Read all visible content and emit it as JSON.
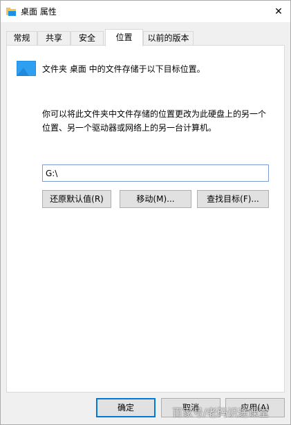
{
  "window": {
    "title": "桌面 属性",
    "close_glyph": "✕"
  },
  "tabs": [
    {
      "label": "常规",
      "active": false
    },
    {
      "label": "共享",
      "active": false
    },
    {
      "label": "安全",
      "active": false
    },
    {
      "label": "位置",
      "active": true
    },
    {
      "label": "以前的版本",
      "active": false
    }
  ],
  "location": {
    "info": "文件夹 桌面 中的文件存储于以下目标位置。",
    "description_line1": "你可以将此文件夹中文件存储的位置更改为此硬盘上的另一个",
    "description_line2": "位置、另一个驱动器或网络上的另一台计算机。",
    "path_value": "G:\\",
    "restore_default_label": "还原默认值(R)",
    "move_label": "移动(M)...",
    "find_target_label": "查找目标(F)..."
  },
  "footer": {
    "ok_label": "确定",
    "cancel_label": "取消",
    "apply_label": "应用(A)"
  },
  "watermark": "百家号/老码识途课堂",
  "colors": {
    "accent": "#0078d7",
    "folder_blue": "#1e90e6",
    "folder_yellow": "#f4c44c"
  }
}
